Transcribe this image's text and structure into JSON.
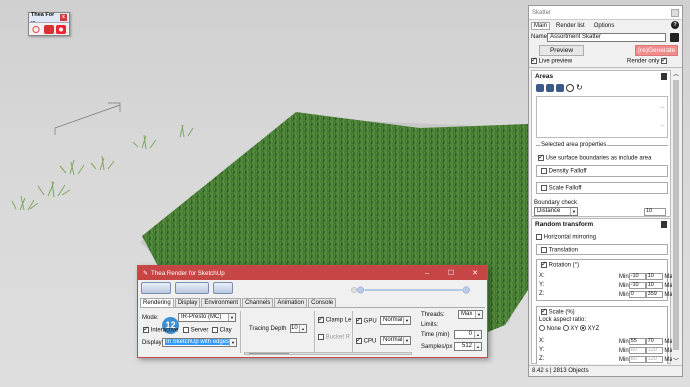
{
  "thea_mini": {
    "title": "Thea For ...",
    "close": "x"
  },
  "thea": {
    "title": "Thea Render for SketchUp",
    "tabs": [
      "Rendering",
      "Display",
      "Environment",
      "Channels",
      "Animation",
      "Console"
    ],
    "mode_label": "Mode:",
    "mode_value": "IR-Presto (MC)",
    "badge": "12",
    "interactive_label": "Interactive",
    "server_label": "Server",
    "clay_label": "Clay",
    "display_label": "Display",
    "display_value": "In SketchUp with edges",
    "tracing_depth_label": "Tracing Depth",
    "tracing_depth_value": "10",
    "clamp_label": "Clamp Le",
    "bucket_label": "Bucket R",
    "gpu_label": "GPU",
    "gpu_value": "Normal",
    "cpu_label": "CPU",
    "cpu_value": "Normal",
    "threads_label": "Threads:",
    "threads_value": "Max",
    "limits_label": "Limits:",
    "time_label": "Time (min)",
    "time_value": "0",
    "samples_label": "Samples/px",
    "samples_value": "512",
    "win_min": "–",
    "win_max": "☐",
    "win_close": "✕"
  },
  "skatter": {
    "title": "Skatter",
    "menu": [
      "Main",
      "Render list",
      "Options"
    ],
    "help": "?",
    "name_label": "Name",
    "name_value": "Assortment Skatter",
    "preview_btn": "Preview",
    "regenerate_btn": "(re)Generate",
    "live_preview_label": "Live preview",
    "render_only_label": "Render only",
    "areas": {
      "title": "Areas",
      "selected_props": "Selected area properties",
      "use_surface_boundaries": "Use surface boundaries as include area",
      "density_falloff": "Density Falloff",
      "scale_falloff": "Scale Falloff",
      "boundary_check_label": "Boundary check",
      "boundary_check_value": "Distance",
      "boundary_value": "10"
    },
    "random_transform": {
      "title": "Random transform",
      "horizontal_mirroring": "Horizontal mirroring",
      "translation": "Translation",
      "rotation": "Rotation (°)",
      "rotation_rows": [
        {
          "axis": "X:",
          "min": "-10",
          "max": "10"
        },
        {
          "axis": "Y:",
          "min": "-10",
          "max": "10"
        },
        {
          "axis": "Z:",
          "min": "0",
          "max": "359"
        }
      ],
      "scale": "Scale (%)",
      "lock_aspect": "Lock aspect ratio:",
      "lock_options": [
        "None",
        "XY",
        "XYZ"
      ],
      "scale_rows": [
        {
          "axis": "X:",
          "min": "55",
          "max": "70"
        },
        {
          "axis": "Y:",
          "min": "80",
          "max": "120"
        },
        {
          "axis": "Z:",
          "min": "80",
          "max": "120"
        }
      ],
      "min_label": "Min",
      "max_label": "Max"
    },
    "status": "8.42 s | 2813 Objects"
  }
}
